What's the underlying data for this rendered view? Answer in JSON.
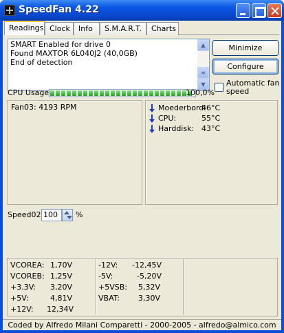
{
  "window": {
    "title": "SpeedFan 4.22"
  },
  "tabs": [
    {
      "label": "Readings",
      "active": true
    },
    {
      "label": "Clock",
      "active": false
    },
    {
      "label": "Info",
      "active": false
    },
    {
      "label": "S.M.A.R.T.",
      "active": false
    },
    {
      "label": "Charts",
      "active": false
    }
  ],
  "log": {
    "lines": [
      "SMART Enabled for drive 0",
      "Found MAXTOR 6L040J2 (40,0GB)",
      "End of detection"
    ]
  },
  "buttons": {
    "minimize": "Minimize",
    "configure": "Configure"
  },
  "auto_fan": {
    "label_line1": "Automatic fan",
    "label_line2": "speed",
    "checked": false
  },
  "cpu": {
    "label": "CPU Usage",
    "value_text": "100,0%",
    "percent": 100
  },
  "fans": [
    {
      "name": "Fan03:",
      "value": "4193 RPM"
    }
  ],
  "temps": [
    {
      "name": "Moederbord:",
      "value": "46°C",
      "trend": "down"
    },
    {
      "name": "CPU:",
      "value": "55°C",
      "trend": "down"
    },
    {
      "name": "Harddisk:",
      "value": "43°C",
      "trend": "down"
    }
  ],
  "speed": {
    "label": "Speed02:",
    "value": "100",
    "unit": "%"
  },
  "voltages_left": [
    {
      "name": "VCOREA:",
      "value": "1,70V"
    },
    {
      "name": "VCOREB:",
      "value": "1,25V"
    },
    {
      "name": "+3.3V:",
      "value": "3,20V"
    },
    {
      "name": "+5V:",
      "value": "4,81V"
    },
    {
      "name": "+12V:",
      "value": "12,34V"
    }
  ],
  "voltages_right": [
    {
      "name": "-12V:",
      "value": "-12,45V"
    },
    {
      "name": "-5V:",
      "value": "-5,20V"
    },
    {
      "name": "+5VSB:",
      "value": "5,32V"
    },
    {
      "name": "VBAT:",
      "value": "3,30V"
    }
  ],
  "footer": "Coded by Alfredo Milani Comparetti - 2000-2005 - alfredo@almico.com",
  "icons": {
    "app": "fan-icon",
    "minimize": "minimize-icon",
    "maximize": "maximize-icon",
    "close": "close-icon",
    "trend_down": "arrow-down-icon"
  }
}
